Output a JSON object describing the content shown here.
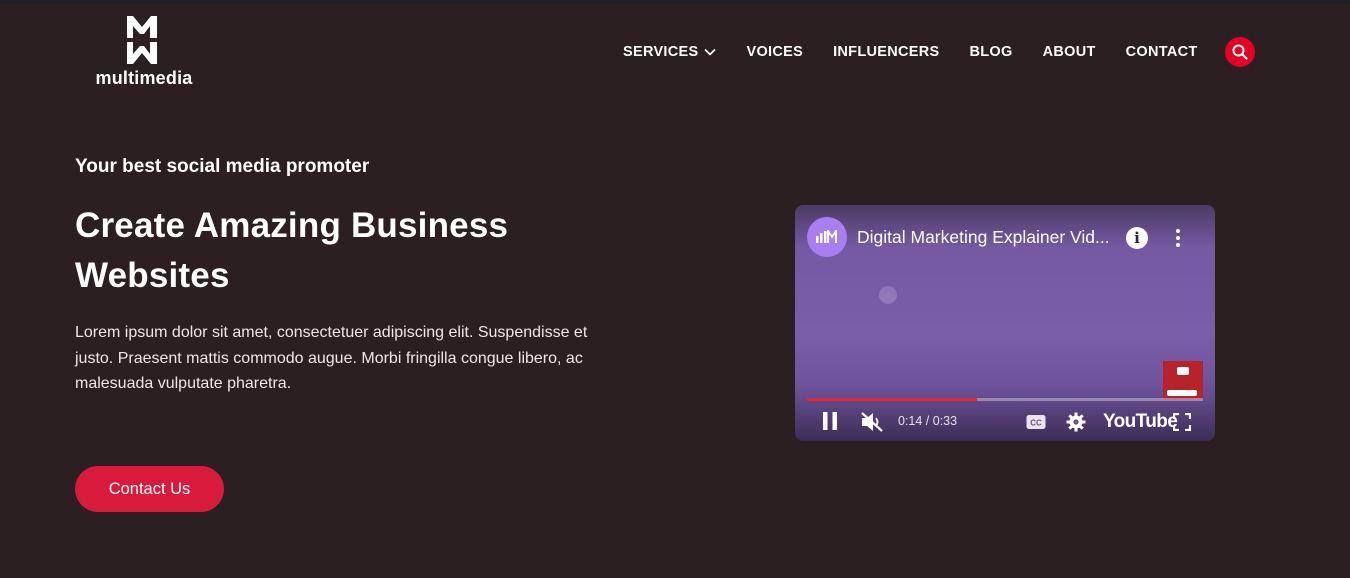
{
  "brand": {
    "logo_text": "multimedia",
    "logo_icon": "mw-monogram-icon"
  },
  "nav": {
    "items": [
      {
        "label": "SERVICES",
        "has_dropdown": true
      },
      {
        "label": "VOICES"
      },
      {
        "label": "INFLUENCERS"
      },
      {
        "label": "BLOG"
      },
      {
        "label": "ABOUT"
      },
      {
        "label": "CONTACT"
      }
    ],
    "search_icon": "search-icon"
  },
  "hero": {
    "eyebrow": "Your best social media promoter",
    "headline_line1": "Create Amazing Business",
    "headline_line2": "Websites",
    "description": "Lorem ipsum dolor sit amet, consectetuer adipiscing elit. Suspendisse et justo. Praesent mattis commodo augue. Morbi fringilla congue libero, ac malesuada vulputate pharetra.",
    "cta_label": "Contact Us"
  },
  "video": {
    "title": "Digital Marketing Explainer Vid...",
    "time": "0:14 / 0:33",
    "progress": 0.43,
    "platform": "YouTube",
    "state": "playing",
    "muted": true
  },
  "colors": {
    "page_background": "#2b1f22",
    "accent_red": "#d81b3c",
    "search_red": "#e60026",
    "video_purple": "#7a5eaa"
  }
}
